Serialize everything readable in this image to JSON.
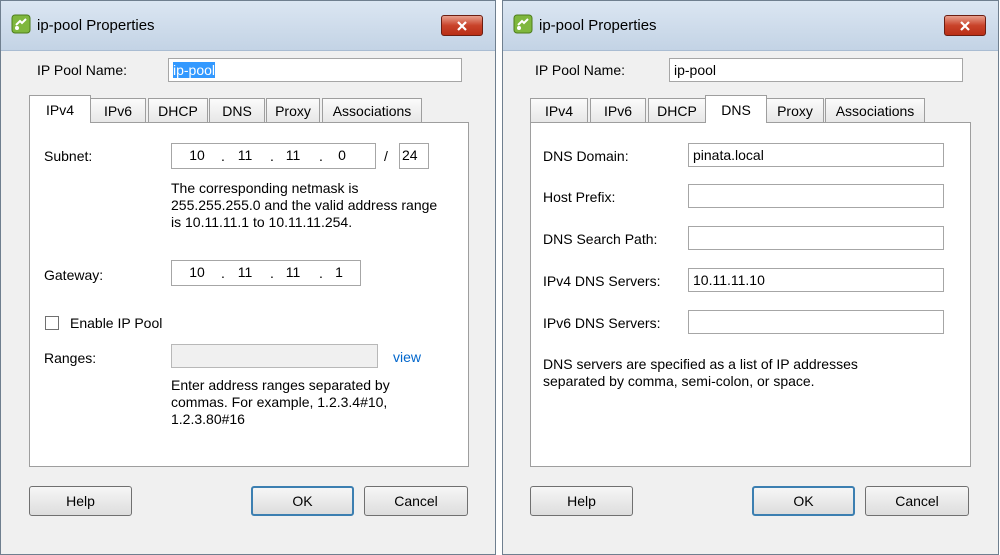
{
  "left": {
    "title": "ip-pool Properties",
    "pool_name_label": "IP Pool Name:",
    "pool_name_value": "ip-pool",
    "tabs": [
      "IPv4",
      "IPv6",
      "DHCP",
      "DNS",
      "Proxy",
      "Associations"
    ],
    "active_tab": "IPv4",
    "subnet_label": "Subnet:",
    "subnet_octets": [
      "10",
      "11",
      "11",
      "0"
    ],
    "subnet_slash": "/",
    "subnet_prefix": "24",
    "netmask_text_1": "The corresponding netmask is",
    "netmask_text_2": "255.255.255.0 and the valid address range",
    "netmask_text_3": "is 10.11.11.1 to 10.11.11.254.",
    "gateway_label": "Gateway:",
    "gateway_octets": [
      "10",
      "11",
      "11",
      "1"
    ],
    "enable_label": "Enable IP Pool",
    "enable_checked": false,
    "ranges_label": "Ranges:",
    "ranges_value": "",
    "view_link": "view",
    "ranges_help_1": "Enter address ranges separated by",
    "ranges_help_2": "commas. For example, 1.2.3.4#10,",
    "ranges_help_3": "1.2.3.80#16",
    "help_button": "Help",
    "ok_button": "OK",
    "cancel_button": "Cancel"
  },
  "right": {
    "title": "ip-pool Properties",
    "pool_name_label": "IP Pool Name:",
    "pool_name_value": "ip-pool",
    "tabs": [
      "IPv4",
      "IPv6",
      "DHCP",
      "DNS",
      "Proxy",
      "Associations"
    ],
    "active_tab": "DNS",
    "dns_domain_label": "DNS Domain:",
    "dns_domain_value": "pinata.local",
    "host_prefix_label": "Host Prefix:",
    "host_prefix_value": "",
    "search_path_label": "DNS Search Path:",
    "search_path_value": "",
    "ipv4_dns_label": "IPv4 DNS Servers:",
    "ipv4_dns_value": "10.11.11.10",
    "ipv6_dns_label": "IPv6 DNS Servers:",
    "ipv6_dns_value": "",
    "dns_note_1": "DNS servers are specified as a list of IP addresses",
    "dns_note_2": "separated by comma, semi-colon, or space.",
    "help_button": "Help",
    "ok_button": "OK",
    "cancel_button": "Cancel"
  },
  "colors": {
    "accent": "#3399ff",
    "link": "#0066cc",
    "close": "#c9432a"
  },
  "icons": {
    "app": "vsphere-ip-pool-icon",
    "close": "close-icon"
  }
}
